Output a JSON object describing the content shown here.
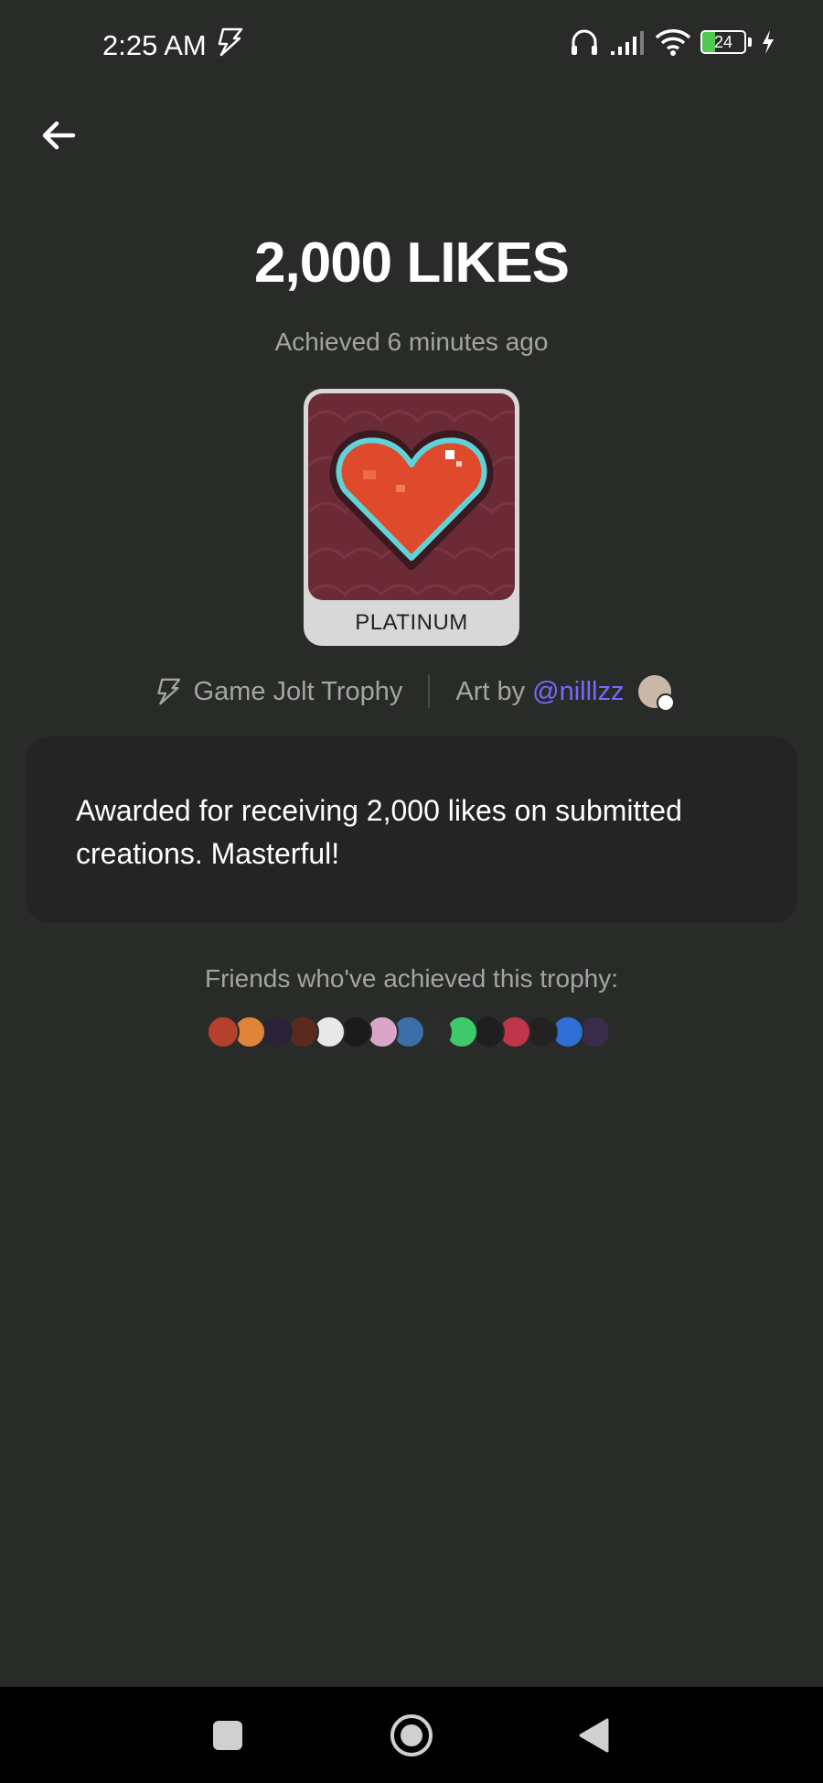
{
  "status_bar": {
    "time": "2:25 AM",
    "battery": "24"
  },
  "trophy": {
    "title": "2,000 LIKES",
    "achieved": "Achieved 6 minutes ago",
    "tier": "PLATINUM",
    "source": "Game Jolt Trophy",
    "art_by_label": "Art by",
    "artist": "@nilllzz",
    "description": "Awarded for receiving 2,000 likes on submitted creations. Masterful!"
  },
  "friends": {
    "label": "Friends who've achieved this trophy:",
    "avatar_colors": [
      "#b5412d",
      "#e0843a",
      "#2a2236",
      "#5a2a1e",
      "#e8e8e8",
      "#1a1a1a",
      "#d9a6c8",
      "#3c6ea8",
      "#2b2b2b",
      "#3ec96a",
      "#1e1e1e",
      "#c0354a",
      "#222222",
      "#2f6fd6",
      "#3a2b4a"
    ]
  },
  "colors": {
    "accent_link": "#7a68ff",
    "background": "#292b29",
    "card": "#232423",
    "muted_text": "#a3a5a2"
  }
}
